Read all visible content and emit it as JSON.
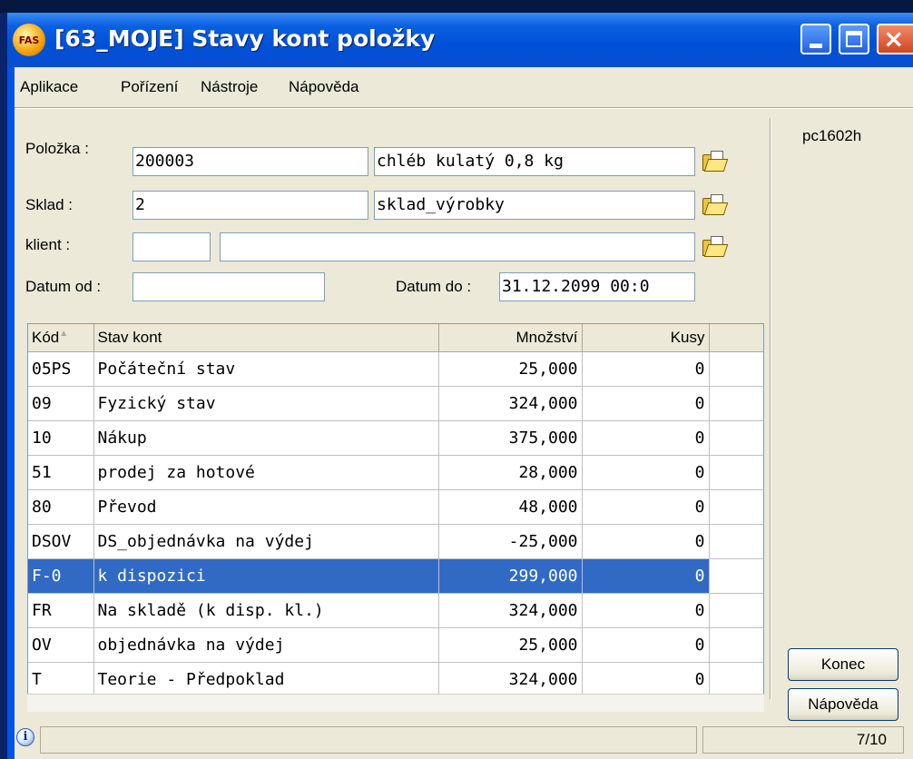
{
  "window": {
    "app_logo": "FAS",
    "title": "[63_MOJE] Stavy kont položky"
  },
  "menu": [
    "Aplikace",
    "Pořízení",
    "Nástroje",
    "Nápověda"
  ],
  "hostname": "pc1602h",
  "form": {
    "polozka": {
      "label": "Položka :",
      "code": "200003",
      "name": "chléb kulatý 0,8 kg"
    },
    "sklad": {
      "label": "Sklad :",
      "code": "2",
      "name": "sklad_výrobky"
    },
    "klient": {
      "label": "klient :",
      "code": "",
      "name": ""
    },
    "datum_od": {
      "label": "Datum od :",
      "value": ""
    },
    "datum_do": {
      "label": "Datum do :",
      "value": "31.12.2099 00:0"
    }
  },
  "table": {
    "columns": [
      "Kód",
      "Stav kont",
      "Množství",
      "Kusy"
    ],
    "rows": [
      {
        "kod": "05PS",
        "stav": "Počáteční stav",
        "mnozstvi": "25,000",
        "kusy": "0"
      },
      {
        "kod": "09",
        "stav": "Fyzický stav",
        "mnozstvi": "324,000",
        "kusy": "0"
      },
      {
        "kod": "10",
        "stav": "Nákup",
        "mnozstvi": "375,000",
        "kusy": "0"
      },
      {
        "kod": "51",
        "stav": "prodej za hotové",
        "mnozstvi": "28,000",
        "kusy": "0"
      },
      {
        "kod": "80",
        "stav": "Převod",
        "mnozstvi": "48,000",
        "kusy": "0"
      },
      {
        "kod": "DSOV",
        "stav": "DS_objednávka na výdej",
        "mnozstvi": "-25,000",
        "kusy": "0"
      },
      {
        "kod": "F-0",
        "stav": "k dispozici",
        "mnozstvi": "299,000",
        "kusy": "0"
      },
      {
        "kod": "FR",
        "stav": "Na skladě (k disp. kl.)",
        "mnozstvi": "324,000",
        "kusy": "0"
      },
      {
        "kod": "OV",
        "stav": "objednávka na výdej",
        "mnozstvi": "25,000",
        "kusy": "0"
      },
      {
        "kod": "T",
        "stav": "Teorie - Předpoklad",
        "mnozstvi": "324,000",
        "kusy": "0"
      }
    ],
    "selected_row": 6
  },
  "buttons": {
    "konec": "Konec",
    "napoveda": "Nápověda"
  },
  "status": {
    "record": "7/10"
  },
  "colors": {
    "selection": "#316ac5",
    "titlebar": "#0054e3",
    "face": "#ece9d8"
  }
}
